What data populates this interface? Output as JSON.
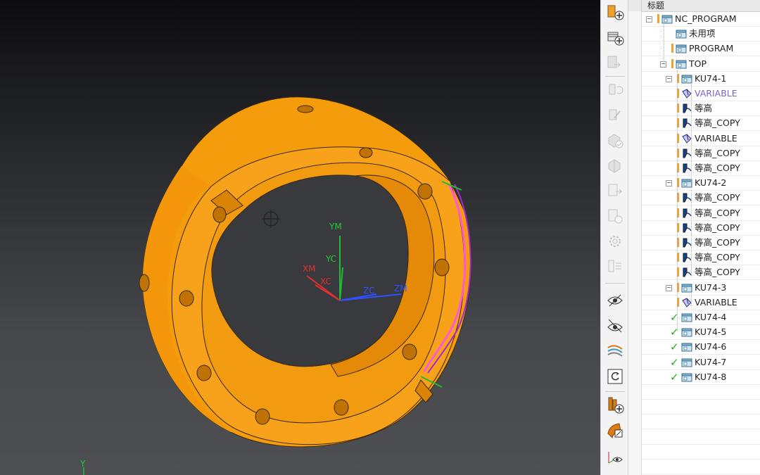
{
  "viewport": {
    "axis_labels": {
      "ym": "YM",
      "yc": "YC",
      "xm": "XM",
      "xc": "XC",
      "zc": "ZC",
      "zm": "ZM",
      "y_bottom": "Y"
    },
    "colors": {
      "part": "#f59c0d",
      "part_dark": "#d37f05",
      "edge": "#3a2a10",
      "path_pink": "#ff5ad1",
      "path_purple": "#a22ad0",
      "axis_green": "#22bb33",
      "axis_red": "#e23030",
      "axis_blue": "#3050ff"
    }
  },
  "toolbar": {
    "icons": [
      "create-program-icon",
      "create-method-icon",
      "move-operation-icon",
      "reorder-icon",
      "generate-icon",
      "verify-icon",
      "machine-icon",
      "post-process-icon",
      "shop-doc-icon",
      "settings-icon",
      "list-icon",
      "hide-icon",
      "show-hidden-icon",
      "display-path-icon",
      "replay-icon",
      "create-tool-icon",
      "create-geometry-icon",
      "display-axis-icon"
    ]
  },
  "navigator": {
    "header": "标题",
    "rows": [
      {
        "label": "NC_PROGRAM",
        "icon": "program-folder-icon",
        "excl": true,
        "toggle": "−"
      },
      {
        "label": "未用项",
        "icon": "program-folder-icon"
      },
      {
        "label": "PROGRAM",
        "icon": "program-folder-icon",
        "excl": true
      },
      {
        "label": "TOP",
        "icon": "program-folder-icon",
        "excl": true,
        "toggle": "−"
      },
      {
        "label": "KU74-1",
        "icon": "program-folder-icon",
        "excl": true,
        "toggle": "−"
      },
      {
        "label": "VARIABLE",
        "icon": "variable-contour-icon",
        "excl": true,
        "purple": true
      },
      {
        "label": "等高",
        "icon": "zlevel-icon",
        "excl": true
      },
      {
        "label": "等高_COPY",
        "icon": "zlevel-icon",
        "excl": true
      },
      {
        "label": "VARIABLE",
        "icon": "variable-contour-icon",
        "excl": true
      },
      {
        "label": "等高_COPY",
        "icon": "zlevel-icon",
        "excl": true
      },
      {
        "label": "等高_COPY",
        "icon": "zlevel-icon",
        "excl": true
      },
      {
        "label": "KU74-2",
        "icon": "program-folder-icon",
        "excl": true,
        "toggle": "−"
      },
      {
        "label": "等高_COPY",
        "icon": "zlevel-icon",
        "excl": true
      },
      {
        "label": "等高_COPY",
        "icon": "zlevel-icon",
        "excl": true
      },
      {
        "label": "等高_COPY",
        "icon": "zlevel-icon",
        "excl": true
      },
      {
        "label": "等高_COPY",
        "icon": "zlevel-icon",
        "excl": true
      },
      {
        "label": "等高_COPY",
        "icon": "zlevel-icon",
        "excl": true
      },
      {
        "label": "等高_COPY",
        "icon": "zlevel-icon",
        "excl": true
      },
      {
        "label": "KU74-3",
        "icon": "program-folder-icon",
        "excl": true,
        "toggle": "−"
      },
      {
        "label": "VARIABLE",
        "icon": "variable-contour-icon",
        "excl": true
      },
      {
        "label": "KU74-4",
        "icon": "program-folder-icon",
        "check": true
      },
      {
        "label": "KU74-5",
        "icon": "program-folder-icon",
        "check": true
      },
      {
        "label": "KU74-6",
        "icon": "program-folder-icon",
        "check": true
      },
      {
        "label": "KU74-7",
        "icon": "program-folder-icon",
        "check": true
      },
      {
        "label": "KU74-8",
        "icon": "program-folder-icon",
        "check": true
      }
    ]
  }
}
